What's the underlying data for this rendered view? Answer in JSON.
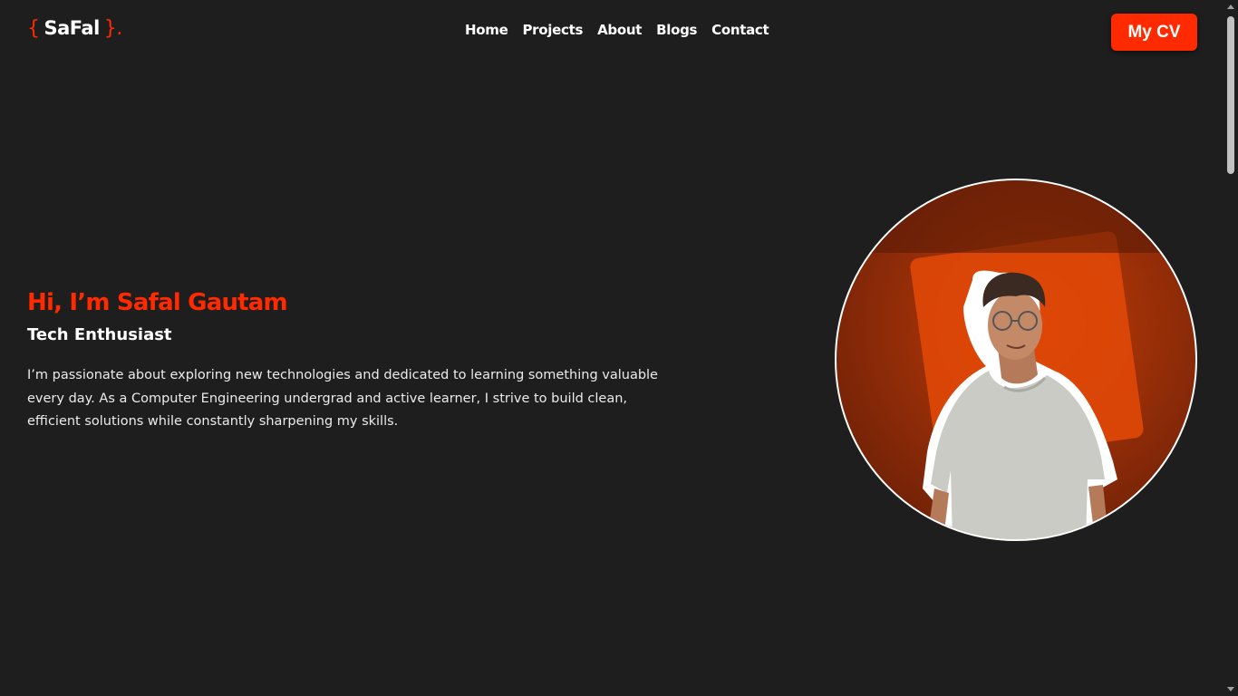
{
  "header": {
    "logo": {
      "open_brace": "{",
      "name": "SaFal",
      "close_brace": "}."
    },
    "nav": [
      "Home",
      "Projects",
      "About",
      "Blogs",
      "Contact"
    ],
    "cv_button": "My CV"
  },
  "hero": {
    "title": "Hi, I’m Safal Gautam",
    "subtitle": "Tech Enthusiast",
    "description": "I’m passionate about exploring new technologies and dedicated to learning something valuable every day. As a Computer Engineering undergrad and active learner, I strive to build clean, efficient solutions while constantly sharpening my skills."
  },
  "colors": {
    "accent": "#ff2a00",
    "background": "#1e1e1e",
    "text": "#ffffff"
  }
}
